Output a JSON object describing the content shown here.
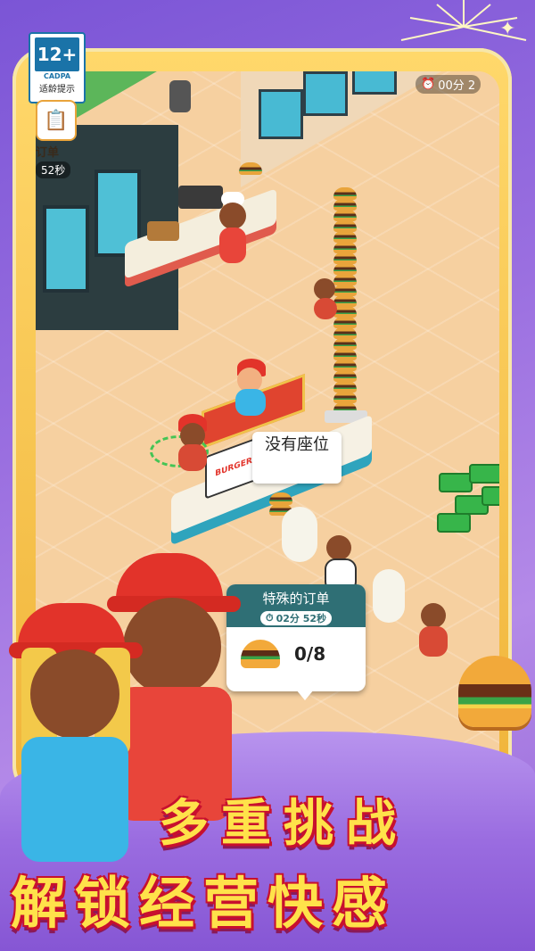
{
  "age_rating": {
    "number": "12+",
    "org": "CADPA",
    "tip": "适龄提示"
  },
  "hud": {
    "order_label": "订单",
    "order_time": "52秒",
    "top_timer": "00分 2"
  },
  "scene": {
    "no_seat_bubble": "没有座位",
    "stall_sign": "BURGER"
  },
  "special_order": {
    "title": "特殊的订单",
    "time": "02分 52秒",
    "progress": "0/8"
  },
  "slogans": {
    "line1": "多重挑战",
    "line2": "解锁经营快感"
  },
  "colors": {
    "background": "#8a5fd0",
    "frame": "#f0b43a",
    "slogan_fill": "#ffe24a",
    "slogan_outline": "#c8102e",
    "order_header": "#2f6f75"
  }
}
